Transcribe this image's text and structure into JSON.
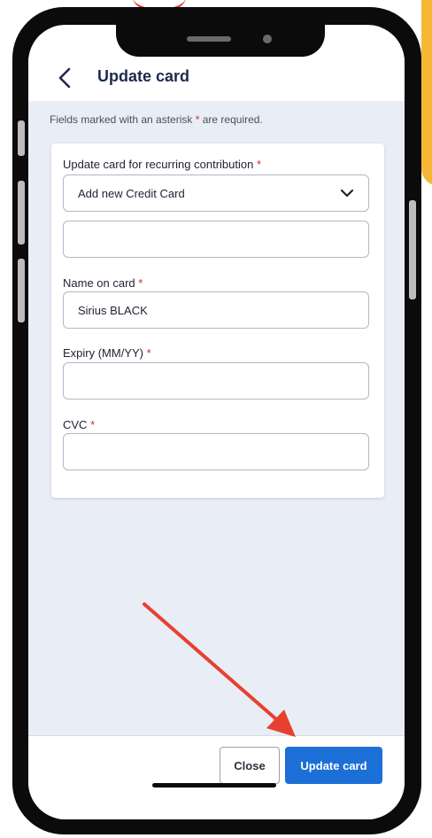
{
  "header": {
    "back_icon": "chevron-left-icon",
    "title": "Update card"
  },
  "notice": {
    "prefix": "Fields marked with an asterisk",
    "star": "*",
    "suffix": "are required."
  },
  "form": {
    "card_select": {
      "label": "Update card for recurring contribution",
      "required_mark": "*",
      "value": "Add new Credit Card",
      "icon": "chevron-down-icon"
    },
    "card_number": {
      "value": ""
    },
    "name_on_card": {
      "label": "Name on card",
      "required_mark": "*",
      "value": "Sirius BLACK"
    },
    "expiry": {
      "label": "Expiry (MM/YY)",
      "required_mark": "*",
      "value": ""
    },
    "cvc": {
      "label": "CVC",
      "required_mark": "*",
      "value": ""
    }
  },
  "footer": {
    "close_label": "Close",
    "update_label": "Update card"
  },
  "colors": {
    "primary": "#1c6fd6",
    "required": "#d62b2b",
    "annotation_arrow": "#e8402f",
    "background_accent": "#f7b733"
  }
}
